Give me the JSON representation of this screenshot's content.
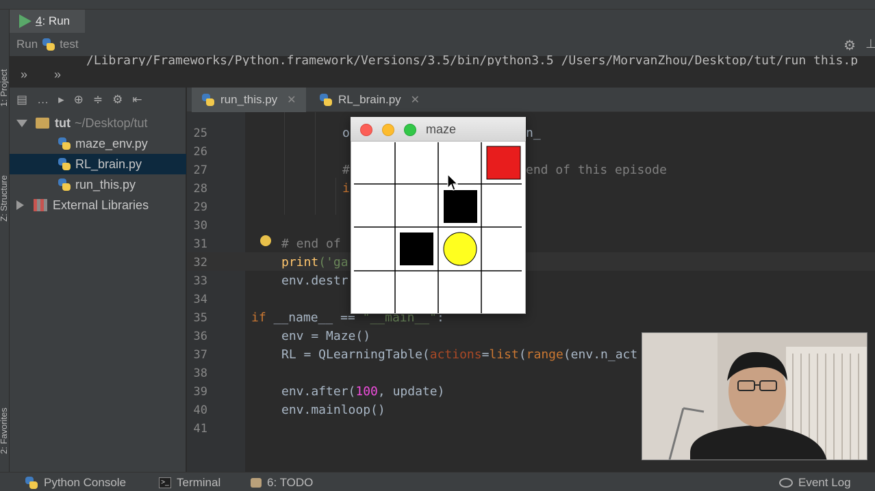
{
  "run_panel": {
    "tab_number": "4",
    "tab_label": ": Run",
    "toolbar_run_label": "Run",
    "toolbar_config_name": "test",
    "console_path": "/Library/Frameworks/Python.framework/Versions/3.5/bin/python3.5 /Users/MorvanZhou/Desktop/tut/run_this.p",
    "chevron": "»"
  },
  "left_strip": {
    "project_label": "1: Project",
    "structure_label": "Z: Structure",
    "favorites_label": "2: Favorites"
  },
  "project_tree": {
    "root_name": "tut",
    "root_path": "~/Desktop/tut",
    "files": [
      "maze_env.py",
      "RL_brain.py",
      "run_this.py"
    ],
    "selected_file": "RL_brain.py",
    "external_label": "External Libraries"
  },
  "editor_tabs": [
    {
      "label": "run_this.py",
      "active": true
    },
    {
      "label": "RL_brain.py",
      "active": false
    }
  ],
  "editor": {
    "line_numbers": [
      "25",
      "26",
      "27",
      "28",
      "29",
      "30",
      "31",
      "32",
      "33",
      "34",
      "35",
      "36",
      "37",
      "38",
      "39",
      "40",
      "41"
    ],
    "fragments": {
      "l25_a": "o",
      "l25_b": "n_",
      "l27_a": "#",
      "l27_b": "end of this episode",
      "l28_a": "i",
      "l31_comment": "# end of",
      "l32_fn": "print",
      "l32_rest": "('ga",
      "l33": "env.destr",
      "l35_if": "if",
      "l35_name": "__name__",
      "l35_eq": "==",
      "l35_main": "\"__main__\"",
      "l35_colon": ":",
      "l36": "env = Maze()",
      "l37_a": "RL = QLearningTable(",
      "l37_param": "actions",
      "l37_b": "=",
      "l37_list": "list",
      "l37_c": "(",
      "l37_range": "range",
      "l37_d": "(env.n_act",
      "l39_a": "env.after(",
      "l39_num": "100",
      "l39_b": ", update)",
      "l40": "env.mainloop()"
    }
  },
  "maze_window": {
    "title": "maze",
    "grid_size": 4,
    "goal_color": "#e81d1d",
    "agent_color": "#ffff1f",
    "hell_color": "#000000"
  },
  "bottom_bar": {
    "python_console": "Python Console",
    "terminal": "Terminal",
    "todo": "6: TODO",
    "event_log": "Event Log"
  },
  "colors": {
    "editor_bg": "#2b2b2b",
    "panel_bg": "#3c3f41",
    "keyword": "#cc7832",
    "comment": "#808080",
    "number": "#ed4ddb",
    "play_green": "#59a869"
  }
}
